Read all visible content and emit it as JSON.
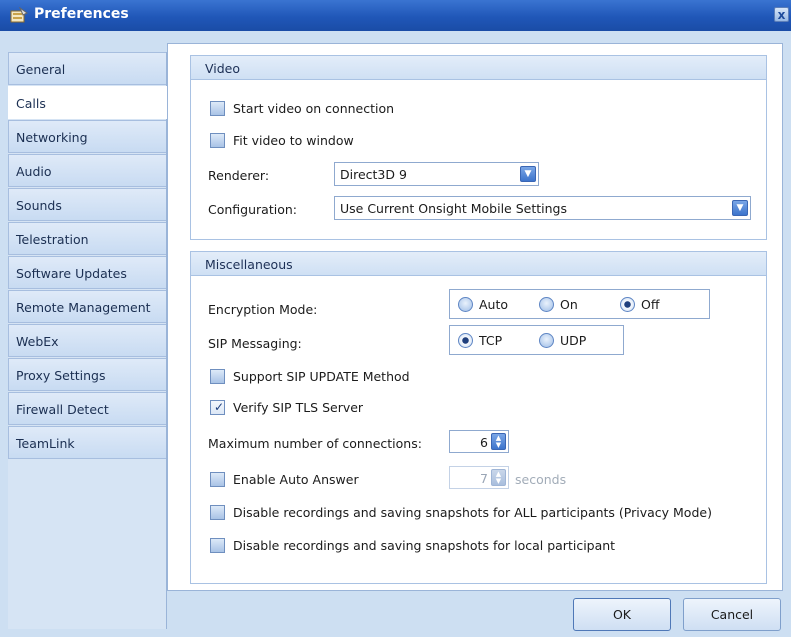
{
  "window": {
    "title": "Preferences",
    "close_glyph": "x",
    "title_icon": "preferences-icon"
  },
  "sidebar": {
    "tabs": [
      {
        "label": "General",
        "active": false
      },
      {
        "label": "Calls",
        "active": true
      },
      {
        "label": "Networking",
        "active": false
      },
      {
        "label": "Audio",
        "active": false
      },
      {
        "label": "Sounds",
        "active": false
      },
      {
        "label": "Telestration",
        "active": false
      },
      {
        "label": "Software Updates",
        "active": false
      },
      {
        "label": "Remote Management",
        "active": false
      },
      {
        "label": "WebEx",
        "active": false
      },
      {
        "label": "Proxy Settings",
        "active": false
      },
      {
        "label": "Firewall Detect",
        "active": false
      },
      {
        "label": "TeamLink",
        "active": false
      }
    ]
  },
  "video": {
    "header": "Video",
    "start_video": {
      "label": "Start video on connection",
      "checked": false
    },
    "fit_video": {
      "label": "Fit video to window",
      "checked": false
    },
    "renderer": {
      "label": "Renderer:",
      "value": "Direct3D 9"
    },
    "configuration": {
      "label": "Configuration:",
      "value": "Use Current Onsight Mobile Settings"
    }
  },
  "misc": {
    "header": "Miscellaneous",
    "encryption": {
      "label": "Encryption Mode:",
      "options": [
        "Auto",
        "On",
        "Off"
      ],
      "selected": "Off"
    },
    "sip": {
      "label": "SIP Messaging:",
      "options": [
        "TCP",
        "UDP"
      ],
      "selected": "TCP"
    },
    "support_update": {
      "label": "Support SIP UPDATE Method",
      "checked": false
    },
    "verify_tls": {
      "label": "Verify SIP TLS Server",
      "checked": true
    },
    "max_connections": {
      "label": "Maximum number of connections:",
      "value": "6"
    },
    "auto_answer": {
      "label": "Enable Auto Answer",
      "checked": false,
      "value": "7",
      "unit": "seconds"
    },
    "disable_all": {
      "label": "Disable recordings and saving snapshots for ALL participants (Privacy Mode)",
      "checked": false
    },
    "disable_local": {
      "label": "Disable recordings and saving snapshots for local participant",
      "checked": false
    }
  },
  "footer": {
    "ok_label": "OK",
    "cancel_label": "Cancel"
  },
  "glyphs": {
    "check": "✓",
    "dropdown": "▼",
    "spin_up": "▲",
    "spin_down": "▼"
  },
  "colors": {
    "titlebar": "#2057b8",
    "accent": "#3d74cc",
    "panel": "#cddff2"
  }
}
